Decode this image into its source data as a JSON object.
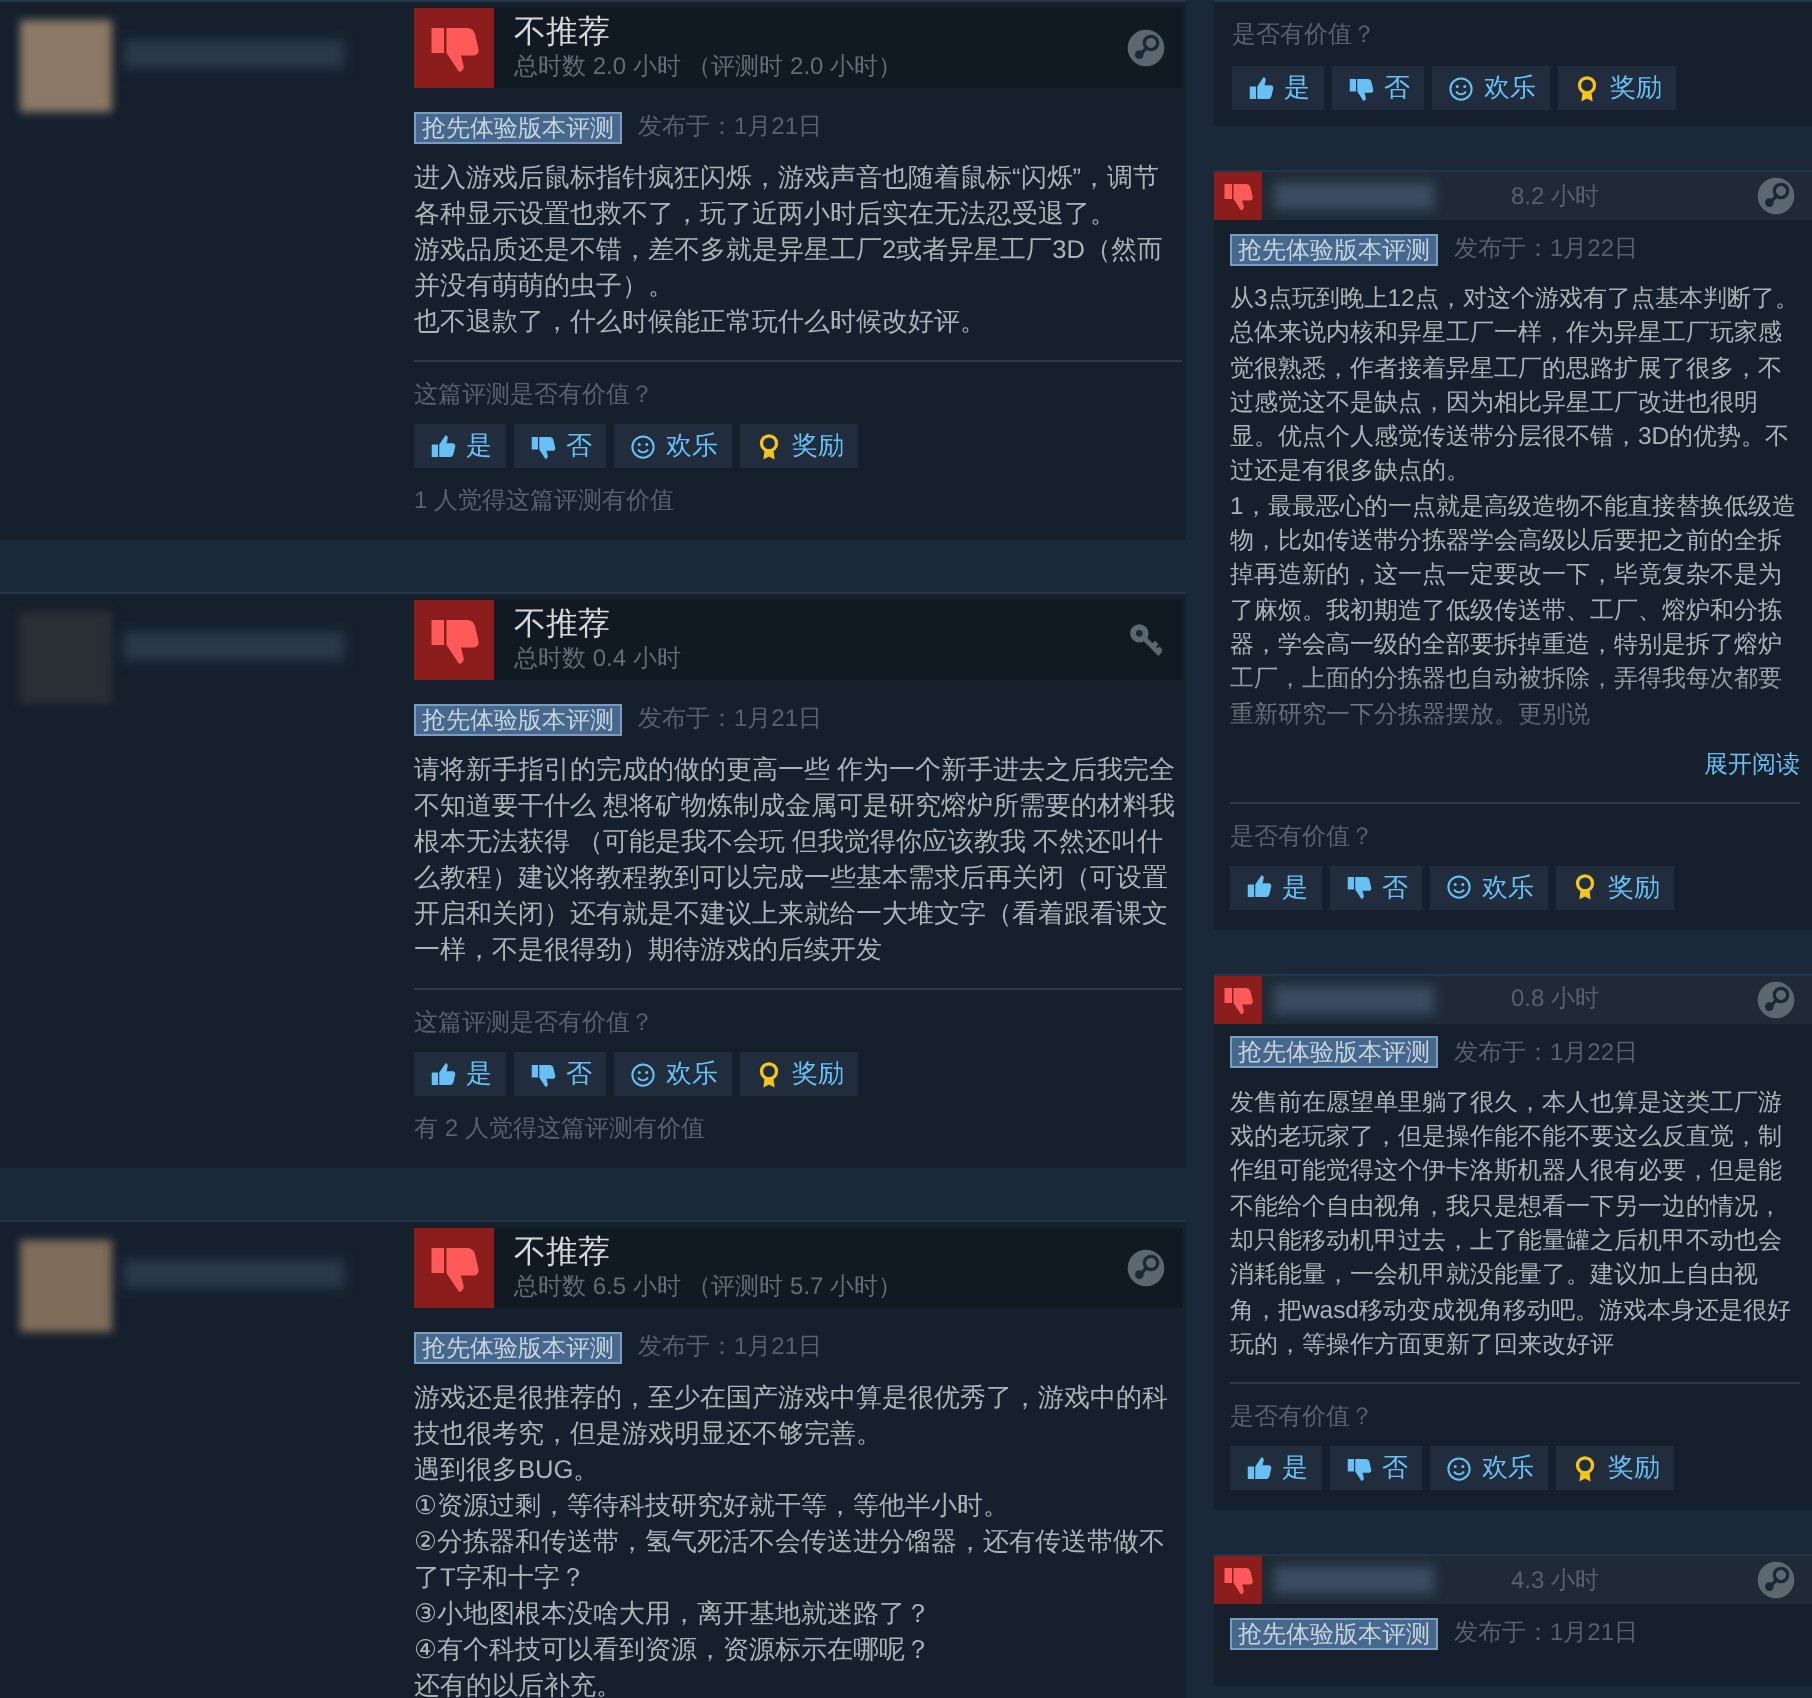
{
  "left_reviews": [
    {
      "recommended": false,
      "verdict": "不推荐",
      "hours": "总时数 2.0 小时 （评测时 2.0 小时）",
      "kind": "steam",
      "tag": "抢先体验版本评测",
      "posted": "发布于：1月21日",
      "paragraphs": [
        "进入游戏后鼠标指针疯狂闪烁，游戏声音也随着鼠标“闪烁”，调节各种显示设置也救不了，玩了近两小时后实在无法忍受退了。",
        "游戏品质还是不错，差不多就是异星工厂2或者异星工厂3D（然而并没有萌萌的虫子）。",
        "也不退款了，什么时候能正常玩什么时候改好评。"
      ],
      "helpful_prompt": "这篇评测是否有价值？",
      "votes": [
        {
          "kind": "yes",
          "label": "是"
        },
        {
          "kind": "no",
          "label": "否"
        },
        {
          "kind": "funny",
          "label": "欢乐"
        },
        {
          "kind": "award",
          "label": "奖励"
        }
      ],
      "helpful_count": "1 人觉得这篇评测有价值"
    },
    {
      "recommended": false,
      "verdict": "不推荐",
      "hours": "总时数 0.4 小时",
      "kind": "key",
      "tag": "抢先体验版本评测",
      "posted": "发布于：1月21日",
      "paragraphs": [
        "请将新手指引的完成的做的更高一些 作为一个新手进去之后我完全不知道要干什么 想将矿物炼制成金属可是研究熔炉所需要的材料我根本无法获得 （可能是我不会玩 但我觉得你应该教我 不然还叫什么教程）建议将教程教到可以完成一些基本需求后再关闭（可设置开启和关闭）还有就是不建议上来就给一大堆文字（看着跟看课文一样，不是很得劲）期待游戏的后续开发"
      ],
      "helpful_prompt": "这篇评测是否有价值？",
      "votes": [
        {
          "kind": "yes",
          "label": "是"
        },
        {
          "kind": "no",
          "label": "否"
        },
        {
          "kind": "funny",
          "label": "欢乐"
        },
        {
          "kind": "award",
          "label": "奖励"
        }
      ],
      "helpful_count": "有 2 人觉得这篇评测有价值"
    },
    {
      "recommended": false,
      "verdict": "不推荐",
      "hours": "总时数 6.5 小时 （评测时 5.7 小时）",
      "kind": "steam",
      "tag": "抢先体验版本评测",
      "posted": "发布于：1月21日",
      "paragraphs": [
        "游戏还是很推荐的，至少在国产游戏中算是很优秀了，游戏中的科技也很考究，但是游戏明显还不够完善。",
        "遇到很多BUG。",
        "①资源过剩，等待科技研究好就干等，等他半小时。",
        "②分拣器和传送带，氢气死活不会传送进分馏器，还有传送带做不了T字和十字？",
        "③小地图根本没啥大用，离开基地就迷路了？",
        "④有个科技可以看到资源，资源标示在哪呢？",
        "还有的以后补充。"
      ]
    }
  ],
  "right_reviews": [
    {
      "helpful_prompt": "是否有价值？",
      "votes": [
        {
          "kind": "yes",
          "label": "是"
        },
        {
          "kind": "no",
          "label": "否"
        },
        {
          "kind": "funny",
          "label": "欢乐"
        },
        {
          "kind": "award",
          "label": "奖励"
        }
      ]
    },
    {
      "recommended": false,
      "hours": "8.2 小时",
      "kind": "steam",
      "tag": "抢先体验版本评测",
      "posted": "发布于：1月22日",
      "paragraphs": [
        "从3点玩到晚上12点，对这个游戏有了点基本判断了。总体来说内核和异星工厂一样，作为异星工厂玩家感觉很熟悉，作者接着异星工厂的思路扩展了很多，不过感觉这不是缺点，因为相比异星工厂改进也很明显。优点个人感觉传送带分层很不错，3D的优势。不过还是有很多缺点的。",
        "1，最最恶心的一点就是高级造物不能直接替换低级造物，比如传送带分拣器学会高级以后要把之前的全拆掉再造新的，这一点一定要改一下，毕竟复杂不是为了麻烦。我初期造了低级传送带、工厂、熔炉和分拣器，学会高一级的全部要拆掉重造，特别是拆了熔炉工厂，上面的分拣器也自动被拆除，弄得我每次都要重新研究一下分拣器摆放。更别说"
      ],
      "read_more": "展开阅读",
      "helpful_prompt": "是否有价值？",
      "votes": [
        {
          "kind": "yes",
          "label": "是"
        },
        {
          "kind": "no",
          "label": "否"
        },
        {
          "kind": "funny",
          "label": "欢乐"
        },
        {
          "kind": "award",
          "label": "奖励"
        }
      ]
    },
    {
      "recommended": false,
      "hours": "0.8 小时",
      "kind": "steam",
      "tag": "抢先体验版本评测",
      "posted": "发布于：1月22日",
      "paragraphs": [
        "发售前在愿望单里躺了很久，本人也算是这类工厂游戏的老玩家了，但是操作能不能不要这么反直觉，制作组可能觉得这个伊卡洛斯机器人很有必要，但是能不能给个自由视角，我只是想看一下另一边的情况，却只能移动机甲过去，上了能量罐之后机甲不动也会消耗能量，一会机甲就没能量了。建议加上自由视角，把wasd移动变成视角移动吧。游戏本身还是很好玩的，等操作方面更新了回来改好评"
      ],
      "helpful_prompt": "是否有价值？",
      "votes": [
        {
          "kind": "yes",
          "label": "是"
        },
        {
          "kind": "no",
          "label": "否"
        },
        {
          "kind": "funny",
          "label": "欢乐"
        },
        {
          "kind": "award",
          "label": "奖励"
        }
      ]
    },
    {
      "recommended": false,
      "hours": "4.3 小时",
      "kind": "steam",
      "tag": "抢先体验版本评测",
      "posted": "发布于：1月21日"
    }
  ]
}
